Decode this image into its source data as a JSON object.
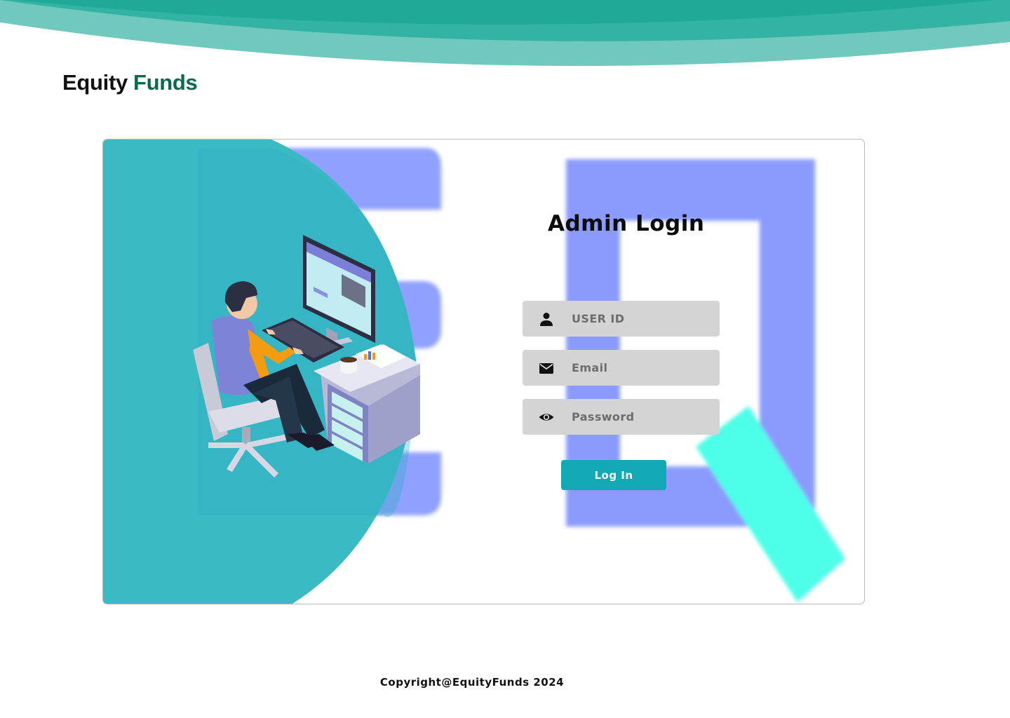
{
  "brand": {
    "word1": "Equity",
    "word2": "Funds",
    "word1_color": "#111111",
    "word2_color": "#0b6a4b"
  },
  "login": {
    "title": "Admin Login",
    "fields": [
      {
        "icon": "user-icon",
        "placeholder": "USER ID",
        "value": ""
      },
      {
        "icon": "envelope-icon",
        "placeholder": "Email",
        "value": ""
      },
      {
        "icon": "eye-icon",
        "placeholder": "Password",
        "value": ""
      }
    ],
    "button_label": "Log In",
    "button_color": "#12a9b5",
    "field_bg": "#d4d4d4"
  },
  "illustration": {
    "subject": "person-at-computer-desk-illustration",
    "background_color": "#3bbac4"
  },
  "footer": {
    "copyright": "Copyright@EquityFunds 2024"
  },
  "colors": {
    "wave_dark": "#1eaa96",
    "wave_mid": "#33b3a3",
    "wave_light": "#70c9bc",
    "decor_blue": "#8a9bfd",
    "decor_cyan": "#4dffe8"
  }
}
